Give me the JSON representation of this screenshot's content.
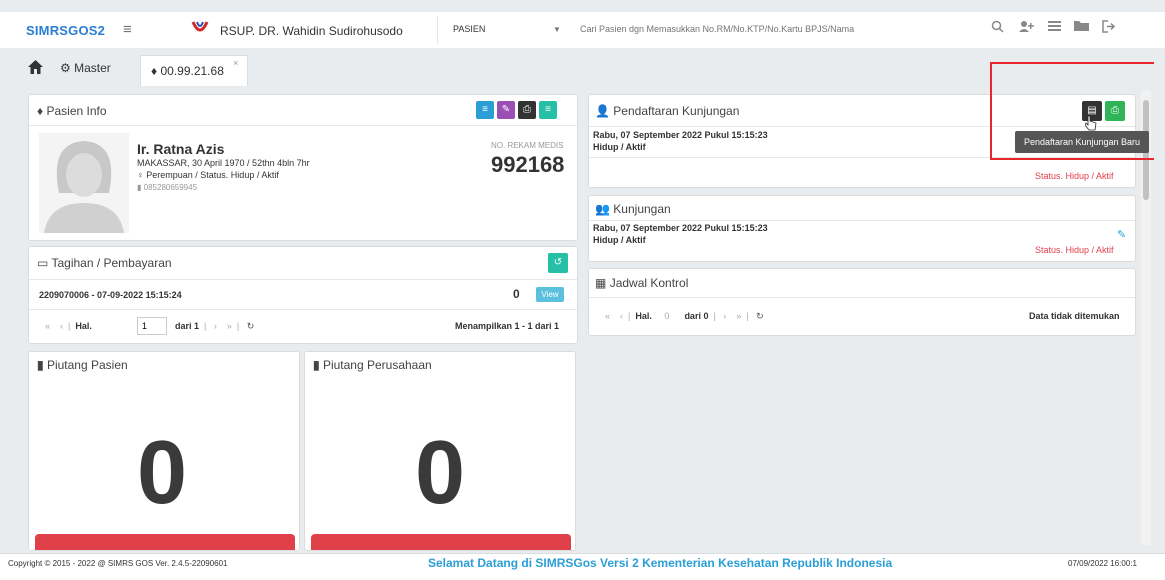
{
  "app": {
    "logo": "SIMRSGOS2",
    "hospital": "RSUP. DR. Wahidin Sudirohusodo",
    "search_category": "PASIEN",
    "search_placeholder": "Cari Pasien dgn Memasukkan No.RM/No.KTP/No.Kartu BPJS/Nama"
  },
  "tabs": {
    "master": "Master",
    "patient": "00.99.21.68",
    "close": "×"
  },
  "patient_info": {
    "title": "Pasien Info",
    "name": "Ir. Ratna Azis",
    "birth": "MAKASSAR, 30 April 1970 / 52thn 4bln 7hr",
    "gender_status": "Perempuan / Status. Hidup / Aktif",
    "phone": "085280659945",
    "rm_label": "NO. REKAM MEDIS",
    "rm_number": "992168"
  },
  "billing": {
    "title": "Tagihan / Pembayaran",
    "row": "2209070006 - 07-09-2022 15:15:24",
    "amount": "0",
    "view": "View",
    "hal": "Hal.",
    "page": "1",
    "of": "dari 1",
    "showing": "Menampilkan 1 - 1 dari 1"
  },
  "piutang_pasien": {
    "title": "Piutang Pasien",
    "value": "0"
  },
  "piutang_perusahaan": {
    "title": "Piutang Perusahaan",
    "value": "0"
  },
  "pendaftaran": {
    "title": "Pendaftaran Kunjungan",
    "date": "Rabu, 07 September 2022 Pukul 15:15:23",
    "status_line": "Hidup / Aktif",
    "status": "Status. Hidup / Aktif",
    "tooltip": "Pendaftaran Kunjungan Baru"
  },
  "kunjungan": {
    "title": "Kunjungan",
    "date": "Rabu, 07 September 2022 Pukul 15:15:23",
    "status_line": "Hidup / Aktif",
    "status": "Status. Hidup / Aktif"
  },
  "jadwal": {
    "title": "Jadwal Kontrol",
    "hal": "Hal.",
    "page": "0",
    "of": "dari 0",
    "empty": "Data tidak ditemukan"
  },
  "footer": {
    "copyright": "Copyright © 2015 - 2022 @ SIMRS GOS Ver. 2.4.5-22090601",
    "marquee": "Selamat Datang di SIMRSGos Versi 2 Kementerian Kesehatan Republik Indonesia",
    "datetime": "07/09/2022 16:00:1"
  },
  "colors": {
    "accent": "#2a9fd6",
    "purple": "#9c4fb3",
    "dark": "#333333",
    "teal": "#26c0a7",
    "green": "#2fb457",
    "red": "#e0404a"
  }
}
